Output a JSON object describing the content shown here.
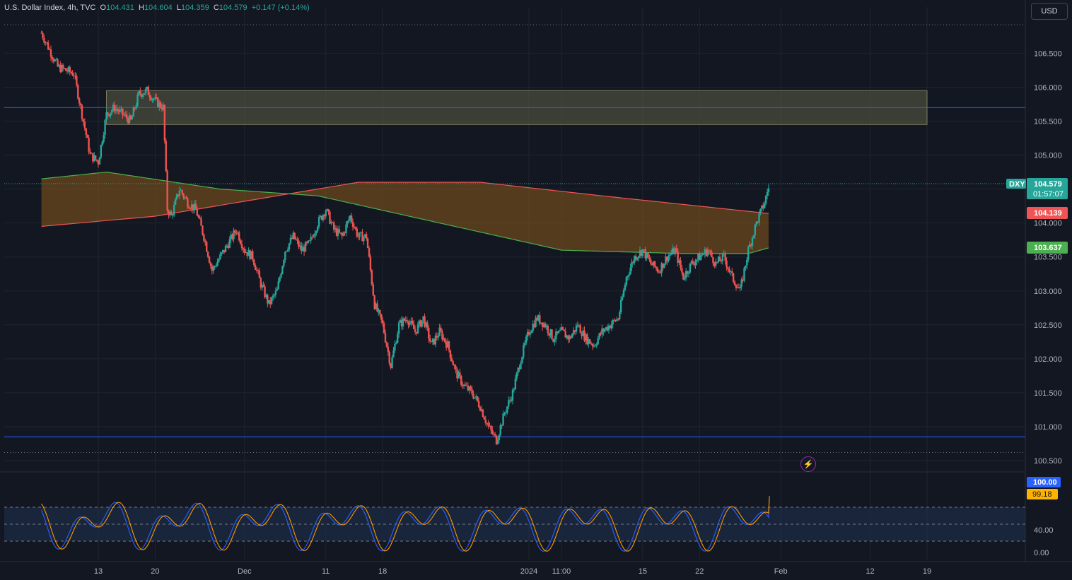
{
  "legend": {
    "symbol": "U.S. Dollar Index, 4h, TVC",
    "o_label": "O",
    "o_value": "104.431",
    "h_label": "H",
    "h_value": "104.604",
    "l_label": "L",
    "l_value": "104.359",
    "c_label": "C",
    "c_value": "104.579",
    "change": "+0.147 (+0.14%)"
  },
  "currency_button": "USD",
  "colors": {
    "background": "#131722",
    "grid": "#1f2430",
    "up": "#26a69a",
    "down": "#ef5350",
    "ma_red": "#f05454",
    "ma_green": "#4caf50",
    "cloud": "#8a5a1a",
    "level_line": "#2962ff",
    "zone": "#5d5f45",
    "stoch_k": "#2962ff",
    "stoch_d": "#ff9800",
    "stoch_band": "#1e2f4d"
  },
  "badges": {
    "price_symbol": "DXY",
    "price": "104.579",
    "countdown": "01:57:07",
    "ma_red_value": "104.139",
    "ma_green_value": "103.637",
    "stoch_k_value": "100.00",
    "stoch_d_value": "99.18"
  },
  "alert_icon": "lightning-icon",
  "chart_data": {
    "type": "candlestick",
    "timeframe": "4h",
    "y_axis": {
      "min": 100.5,
      "max": 106.9,
      "ticks": [
        "106.500",
        "106.000",
        "105.500",
        "105.000",
        "104.500",
        "104.000",
        "103.500",
        "103.000",
        "102.500",
        "102.000",
        "101.500",
        "101.000",
        "100.500"
      ]
    },
    "x_axis": {
      "labels": [
        {
          "text": "13",
          "day": 13
        },
        {
          "text": "20",
          "day": 20
        },
        {
          "text": "Dec",
          "day": 31
        },
        {
          "text": "11",
          "day": 41
        },
        {
          "text": "18",
          "day": 48
        },
        {
          "text": "2024",
          "day": 66
        },
        {
          "text": "11:00",
          "day": 70
        },
        {
          "text": "15",
          "day": 80
        },
        {
          "text": "22",
          "day": 87
        },
        {
          "text": "Feb",
          "day": 97
        },
        {
          "text": "12",
          "day": 108
        },
        {
          "text": "19",
          "day": 115
        }
      ]
    },
    "close_path": [
      [
        6,
        106.8
      ],
      [
        8,
        106.3
      ],
      [
        10,
        106.2
      ],
      [
        11,
        105.6
      ],
      [
        12,
        105.0
      ],
      [
        13,
        104.9
      ],
      [
        14,
        105.6
      ],
      [
        15,
        105.7
      ],
      [
        16,
        105.6
      ],
      [
        17,
        105.5
      ],
      [
        18,
        105.9
      ],
      [
        19,
        105.95
      ],
      [
        20,
        105.8
      ],
      [
        21,
        105.7
      ],
      [
        21.5,
        104.2
      ],
      [
        22,
        104.1
      ],
      [
        23,
        104.5
      ],
      [
        24,
        104.3
      ],
      [
        25,
        104.2
      ],
      [
        26,
        103.8
      ],
      [
        27,
        103.3
      ],
      [
        28,
        103.5
      ],
      [
        29,
        103.7
      ],
      [
        30,
        103.9
      ],
      [
        31,
        103.6
      ],
      [
        32,
        103.5
      ],
      [
        33,
        103.1
      ],
      [
        34,
        102.8
      ],
      [
        35,
        103.0
      ],
      [
        36,
        103.6
      ],
      [
        37,
        103.8
      ],
      [
        38,
        103.6
      ],
      [
        39,
        103.7
      ],
      [
        40,
        104.0
      ],
      [
        41,
        104.2
      ],
      [
        42,
        103.9
      ],
      [
        43,
        103.8
      ],
      [
        44,
        104.1
      ],
      [
        45,
        103.8
      ],
      [
        46,
        103.8
      ],
      [
        47,
        102.8
      ],
      [
        48,
        102.5
      ],
      [
        49,
        101.9
      ],
      [
        50,
        102.5
      ],
      [
        51,
        102.6
      ],
      [
        52,
        102.4
      ],
      [
        53,
        102.6
      ],
      [
        54,
        102.2
      ],
      [
        55,
        102.4
      ],
      [
        56,
        102.2
      ],
      [
        57,
        101.8
      ],
      [
        58,
        101.6
      ],
      [
        59,
        101.5
      ],
      [
        60,
        101.3
      ],
      [
        61,
        101.0
      ],
      [
        62,
        100.8
      ],
      [
        63,
        101.2
      ],
      [
        64,
        101.5
      ],
      [
        65,
        102.0
      ],
      [
        66,
        102.4
      ],
      [
        67,
        102.6
      ],
      [
        68,
        102.5
      ],
      [
        69,
        102.3
      ],
      [
        70,
        102.4
      ],
      [
        71,
        102.3
      ],
      [
        72,
        102.5
      ],
      [
        73,
        102.3
      ],
      [
        74,
        102.2
      ],
      [
        75,
        102.4
      ],
      [
        76,
        102.5
      ],
      [
        77,
        102.6
      ],
      [
        78,
        103.2
      ],
      [
        79,
        103.5
      ],
      [
        80,
        103.6
      ],
      [
        81,
        103.4
      ],
      [
        82,
        103.3
      ],
      [
        83,
        103.5
      ],
      [
        84,
        103.6
      ],
      [
        85,
        103.2
      ],
      [
        86,
        103.4
      ],
      [
        87,
        103.5
      ],
      [
        88,
        103.6
      ],
      [
        89,
        103.4
      ],
      [
        90,
        103.5
      ],
      [
        91,
        103.2
      ],
      [
        92,
        103.0
      ],
      [
        93,
        103.6
      ],
      [
        94,
        104.0
      ],
      [
        95,
        104.3
      ],
      [
        95.6,
        104.579
      ]
    ],
    "ma_red": [
      [
        6,
        103.95
      ],
      [
        20,
        104.1
      ],
      [
        30,
        104.3
      ],
      [
        45,
        104.6
      ],
      [
        60,
        104.6
      ],
      [
        75,
        104.4
      ],
      [
        95.6,
        104.139
      ]
    ],
    "ma_green": [
      [
        6,
        104.65
      ],
      [
        14,
        104.75
      ],
      [
        28,
        104.5
      ],
      [
        40,
        104.4
      ],
      [
        55,
        104.0
      ],
      [
        70,
        103.6
      ],
      [
        85,
        103.55
      ],
      [
        93,
        103.55
      ],
      [
        95.6,
        103.637
      ]
    ],
    "resistance_zone": {
      "top": 105.95,
      "bottom": 105.45,
      "from_day": 14,
      "to_day": 115
    },
    "level_lines": [
      105.7,
      100.85
    ],
    "dotted_lines": [
      106.92,
      100.62
    ],
    "stochastic": {
      "y_ticks": [
        "40.00",
        "0.00"
      ],
      "upper": 80,
      "middle": 50,
      "lower": 20,
      "k_value": 100.0,
      "d_value": 99.18
    }
  }
}
